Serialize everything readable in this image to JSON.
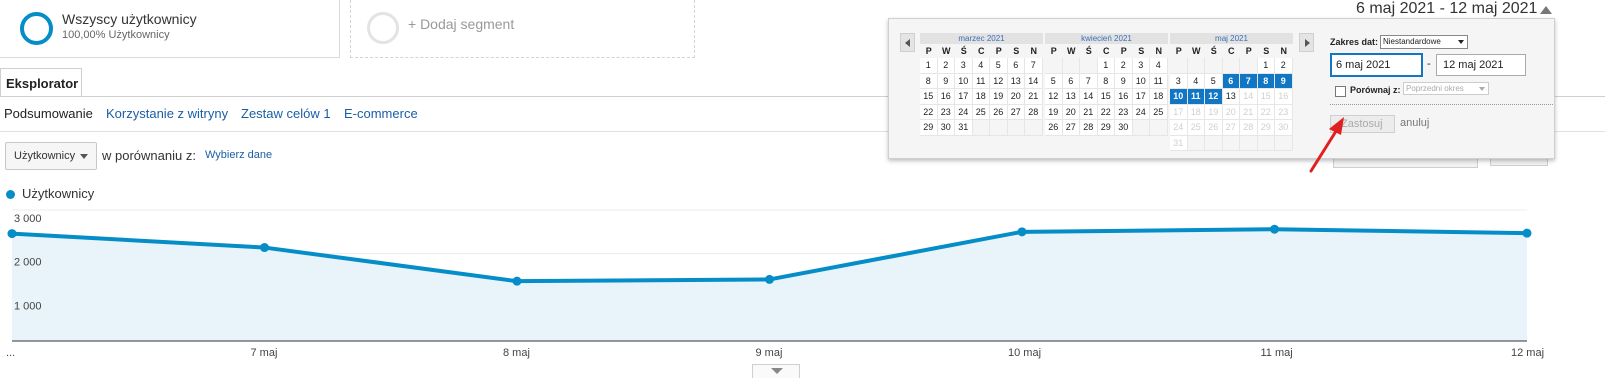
{
  "segments": {
    "active": {
      "title": "Wszyscy użytkownicy",
      "subtitle": "100,00% Użytkownicy"
    },
    "add_label": "+ Dodaj segment"
  },
  "tabs": {
    "main": "Eksplorator",
    "sub": [
      "Podsumowanie",
      "Korzystanie z witryny",
      "Zestaw celów 1",
      "E-commerce"
    ]
  },
  "metric": {
    "selected": "Użytkownicy",
    "compare_label": "w porównaniu z:",
    "compare_link": "Wybierz dane"
  },
  "date_header": {
    "range": "6 maj 2021 - 12 maj 2021"
  },
  "picker": {
    "weekday_labels": [
      "P",
      "W",
      "Ś",
      "C",
      "P",
      "S",
      "N"
    ],
    "months": [
      {
        "name": "marzec 2021",
        "offset": 0,
        "days": 31,
        "trailing": 4,
        "selected": [],
        "disabled_from": null
      },
      {
        "name": "kwiecień 2021",
        "offset": 3,
        "days": 30,
        "trailing": 2,
        "selected": [],
        "disabled_from": null
      },
      {
        "name": "maj 2021",
        "offset": 5,
        "days": 31,
        "trailing": 6,
        "selected": [
          6,
          7,
          8,
          9,
          10,
          11,
          12
        ],
        "disabled_from": 14
      }
    ],
    "zakres_label": "Zakres dat:",
    "zakres_value": "Niestandardowe",
    "start_date": "6 maj 2021",
    "end_date": "12 maj 2021",
    "dash": "-",
    "compare_label": "Porównaj z:",
    "compare_placeholder": "Poprzedni okres",
    "apply_label": "Zastosuj",
    "cancel_label": "anuluj"
  },
  "chart_data": {
    "type": "area",
    "legend": [
      "Użytkownicy"
    ],
    "x": [
      "...",
      "7 maj",
      "8 maj",
      "9 maj",
      "10 maj",
      "11 maj",
      "12 maj"
    ],
    "series": [
      {
        "name": "Użytkownicy",
        "values": [
          2460,
          2140,
          1370,
          1410,
          2500,
          2560,
          2470
        ]
      }
    ],
    "y_ticks": [
      "3 000",
      "2 000",
      "1 000"
    ],
    "ylim": [
      0,
      3000
    ],
    "color": "#058dc7",
    "fill": "#e8f4fa"
  },
  "colors": {
    "accent": "#058dc7",
    "selected_day": "#1177c4",
    "link": "#1a5ea5",
    "annotation_arrow": "#e02020"
  }
}
